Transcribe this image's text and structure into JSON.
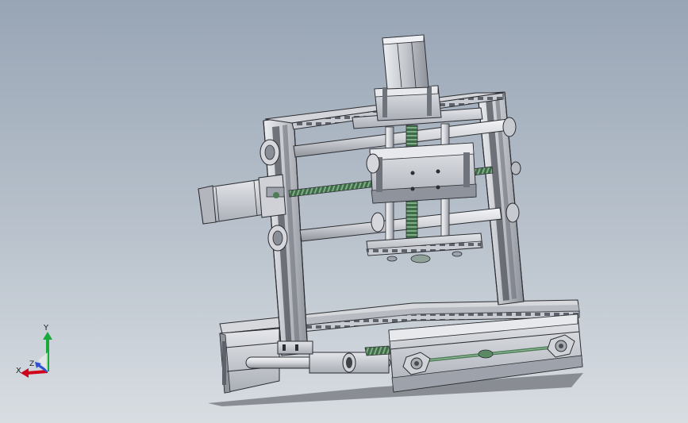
{
  "viewport": {
    "background_top": "#98a5b5",
    "background_bottom": "#d8dde2",
    "model": "cnc-router-3d-model"
  },
  "triad": {
    "x_label": "X",
    "y_label": "Y",
    "z_label": "Z",
    "x_color": "#d0021b",
    "y_color": "#19a83a",
    "z_color": "#2c4fd6"
  },
  "colors": {
    "metal_light": "#d9dbe0",
    "metal_mid": "#b4b7be",
    "metal_dark": "#6f737b",
    "edge": "#2b2d31",
    "rod": "#e3e5ea",
    "screw": "#4e7d58",
    "motor_body": "#c9ccd2"
  }
}
